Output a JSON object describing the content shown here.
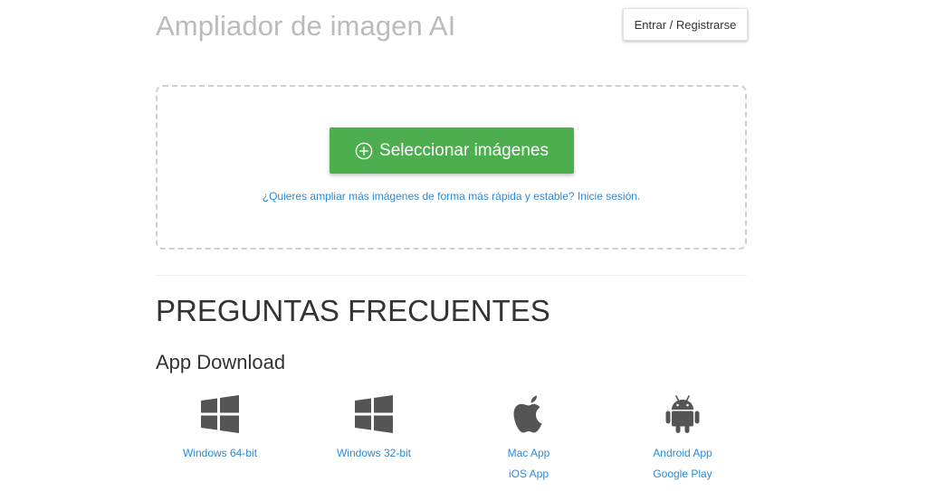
{
  "header": {
    "title": "Ampliador de imagen AI",
    "login_label": "Entrar / Registrarse"
  },
  "upload": {
    "select_label": "Seleccionar imágenes",
    "login_hint": "¿Quieres ampliar más imágenes de forma más rápida y estable? Inicie sesión."
  },
  "faq": {
    "title": "PREGUNTAS FRECUENTES"
  },
  "app_download": {
    "title": "App Download",
    "items": [
      {
        "icon": "windows-icon",
        "links": [
          "Windows 64-bit"
        ]
      },
      {
        "icon": "windows-icon",
        "links": [
          "Windows 32-bit"
        ]
      },
      {
        "icon": "apple-icon",
        "links": [
          "Mac App",
          "iOS App"
        ]
      },
      {
        "icon": "android-icon",
        "links": [
          "Android App",
          "Google Play"
        ]
      }
    ]
  },
  "colors": {
    "primary_green": "#4cae4f",
    "link_blue": "#2a8ad8",
    "title_gray": "#bbbbbb",
    "icon_gray": "#555555"
  }
}
